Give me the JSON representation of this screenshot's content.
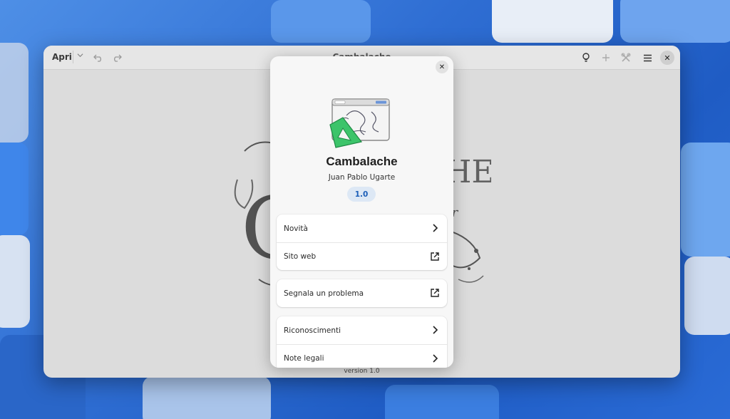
{
  "window": {
    "title": "Cambalache",
    "open_label": "Apri",
    "footer_version": "version 1.0"
  },
  "icons": {
    "open_dropdown": "chevron-down-icon",
    "undo": "undo-icon",
    "redo": "redo-icon",
    "tips": "lightbulb-icon",
    "add": "plus-icon",
    "tools": "tools-icon",
    "menu": "hamburger-menu-icon",
    "close": "close-icon"
  },
  "about": {
    "app_name": "Cambalache",
    "developer": "Juan Pablo Ugarte",
    "version": "1.0",
    "groups": [
      [
        {
          "label": "Novità",
          "icon": "chevron-right-icon"
        },
        {
          "label": "Sito web",
          "icon": "external-link-icon"
        }
      ],
      [
        {
          "label": "Segnala un problema",
          "icon": "external-link-icon"
        }
      ],
      [
        {
          "label": "Riconoscimenti",
          "icon": "chevron-right-icon"
        },
        {
          "label": "Note legali",
          "icon": "chevron-right-icon"
        }
      ]
    ]
  },
  "colors": {
    "accent": "#1c5fb8",
    "badge_bg": "#dde8f5",
    "icon_green": "#3cc46a"
  }
}
